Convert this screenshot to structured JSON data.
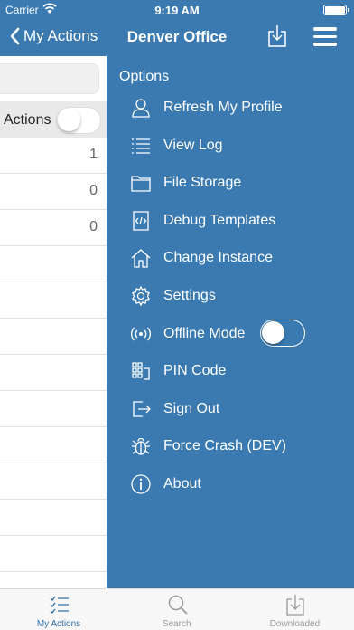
{
  "status_bar": {
    "carrier": "Carrier",
    "time": "9:19 AM"
  },
  "nav": {
    "back_label": "My Actions",
    "title": "Denver Office"
  },
  "underlay": {
    "actions_label": "Actions",
    "counts": [
      "1",
      "0",
      "0",
      "",
      "",
      "",
      "",
      "",
      "",
      "",
      "",
      "",
      ""
    ]
  },
  "menu": {
    "heading": "Options",
    "items": [
      {
        "label": "Refresh My Profile",
        "icon": "user-icon"
      },
      {
        "label": "View Log",
        "icon": "list-icon"
      },
      {
        "label": "File Storage",
        "icon": "folder-icon"
      },
      {
        "label": "Debug Templates",
        "icon": "code-file-icon"
      },
      {
        "label": "Change Instance",
        "icon": "home-icon"
      },
      {
        "label": "Settings",
        "icon": "gear-icon"
      },
      {
        "label": "Offline Mode",
        "icon": "broadcast-icon"
      },
      {
        "label": "PIN Code",
        "icon": "keypad-icon"
      },
      {
        "label": "Sign Out",
        "icon": "sign-out-icon"
      },
      {
        "label": "Force Crash (DEV)",
        "icon": "bug-icon"
      },
      {
        "label": "About",
        "icon": "info-icon"
      }
    ],
    "offline_mode_on": false
  },
  "tabs": [
    {
      "label": "My Actions",
      "icon": "checklist-icon",
      "active": true
    },
    {
      "label": "Search",
      "icon": "search-icon",
      "active": false
    },
    {
      "label": "Downloaded",
      "icon": "download-icon",
      "active": false
    }
  ],
  "colors": {
    "menu_bg": "#3a7ab0",
    "tab_active": "#2f6fa8",
    "tab_inactive": "#999999"
  }
}
